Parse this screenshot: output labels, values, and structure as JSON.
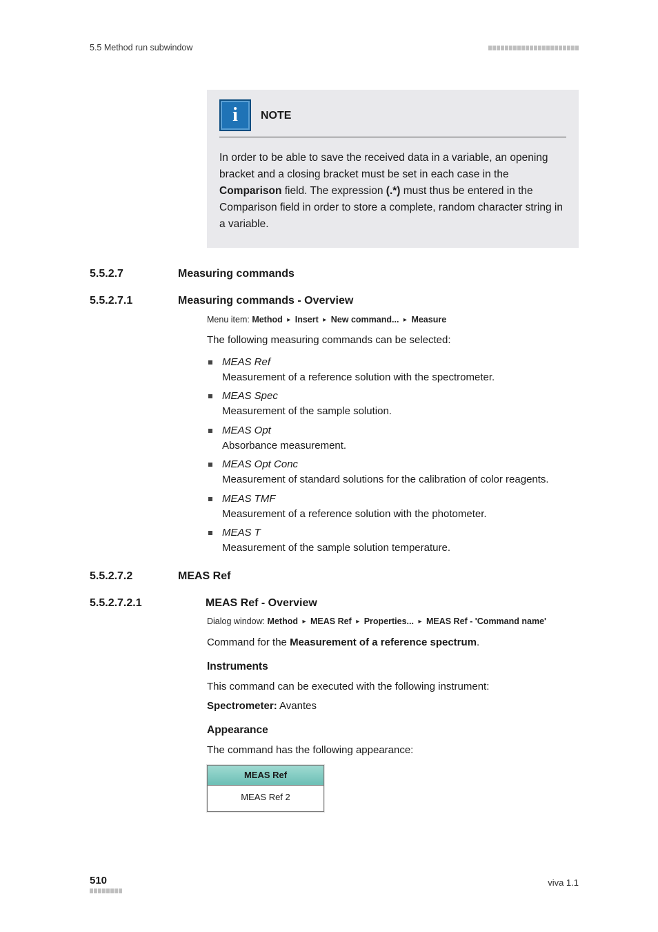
{
  "header": {
    "left": "5.5 Method run subwindow"
  },
  "note": {
    "title": "NOTE",
    "body_pre": "In order to be able to save the received data in a variable, an opening bracket and a closing bracket must be set in each case in the ",
    "body_bold1": "Comparison",
    "body_mid": " field. The expression ",
    "body_bold2": "(.*)",
    "body_post": " must thus be entered in the Comparison field in order to store a complete, random character string in a variable."
  },
  "s1": {
    "num": "5.5.2.7",
    "title": "Measuring commands"
  },
  "s2": {
    "num": "5.5.2.7.1",
    "title": "Measuring commands - Overview",
    "menu_prefix": "Menu item: ",
    "menu": [
      "Method",
      "Insert",
      "New command...",
      "Measure"
    ],
    "intro": "The following measuring commands can be selected:",
    "items": [
      {
        "name": "MEAS Ref",
        "desc": "Measurement of a reference solution with the spectrometer."
      },
      {
        "name": "MEAS Spec",
        "desc": "Measurement of the sample solution."
      },
      {
        "name": "MEAS Opt",
        "desc": "Absorbance measurement."
      },
      {
        "name": "MEAS Opt Conc",
        "desc": "Measurement of standard solutions for the calibration of color reagents."
      },
      {
        "name": "MEAS TMF",
        "desc": "Measurement of a reference solution with the photometer."
      },
      {
        "name": "MEAS T",
        "desc": "Measurement of the sample solution temperature."
      }
    ]
  },
  "s3": {
    "num": "5.5.2.7.2",
    "title": "MEAS Ref"
  },
  "s4": {
    "num": "5.5.2.7.2.1",
    "title": "MEAS Ref - Overview",
    "dialog_prefix": "Dialog window: ",
    "dialog": [
      "Method",
      "MEAS Ref",
      "Properties...",
      "MEAS Ref - 'Command name'"
    ],
    "line_pre": "Command for the ",
    "line_bold": "Measurement of a reference spectrum",
    "line_post": ".",
    "instruments_h": "Instruments",
    "instruments_p": "This command can be executed with the following instrument:",
    "spec_label": "Spectrometer:",
    "spec_value": " Avantes",
    "appearance_h": "Appearance",
    "appearance_p": "The command has the following appearance:",
    "block_hdr": "MEAS Ref",
    "block_body": "MEAS Ref 2"
  },
  "footer": {
    "page": "510",
    "right": "viva 1.1"
  }
}
